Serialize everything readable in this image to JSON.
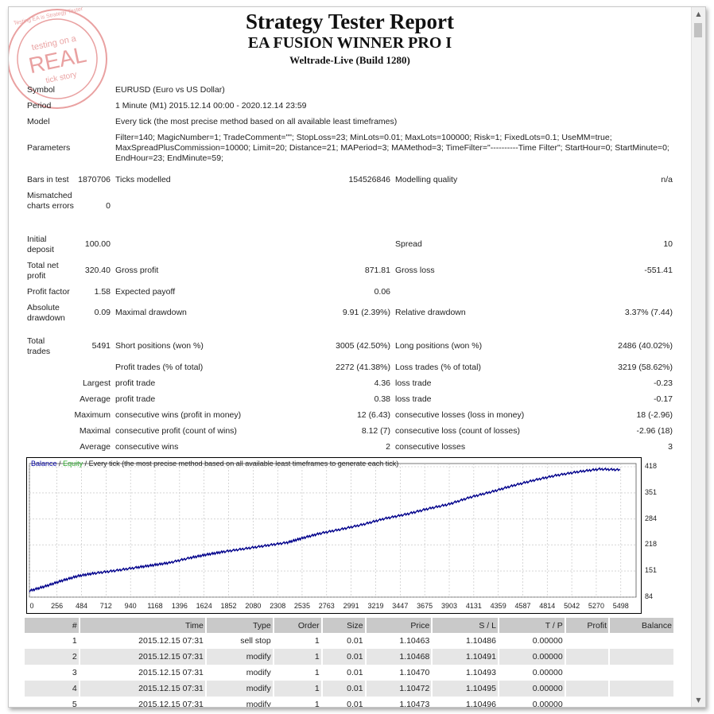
{
  "report": {
    "title": "Strategy Tester Report",
    "ea_name": "EA FUSION WINNER PRO I",
    "server": "Weltrade-Live (Build 1280)"
  },
  "stamp": {
    "text_top": "testing on a",
    "text_main": "REAL",
    "text_bottom": "tick story",
    "ring_text": "Testing EA is Strategy Tester"
  },
  "info": {
    "symbol_label": "Symbol",
    "symbol_value": "EURUSD (Euro vs US Dollar)",
    "period_label": "Period",
    "period_value": "1 Minute (M1) 2015.12.14 00:00 - 2020.12.14 23:59",
    "model_label": "Model",
    "model_value": "Every tick (the most precise method based on all available least timeframes)",
    "parameters_label": "Parameters",
    "parameters_value": "Filter=140; MagicNumber=1; TradeComment=\"\"; StopLoss=23; MinLots=0.01; MaxLots=100000; Risk=1; FixedLots=0.1; UseMM=true; MaxSpreadPlusCommission=10000; Limit=20; Distance=21; MAPeriod=3; MAMethod=3; TimeFilter=\"----------Time Filter\"; StartHour=0; StartMinute=0; EndHour=23; EndMinute=59;"
  },
  "stats": {
    "bars_label": "Bars in test",
    "bars_value": "1870706",
    "ticks_label": "Ticks modelled",
    "ticks_value": "154526846",
    "quality_label": "Modelling quality",
    "quality_value": "n/a",
    "mismatch_label": "Mismatched charts errors",
    "mismatch_value": "0",
    "deposit_label": "Initial deposit",
    "deposit_value": "100.00",
    "spread_label": "Spread",
    "spread_value": "10",
    "netprofit_label": "Total net profit",
    "netprofit_value": "320.40",
    "grossprofit_label": "Gross profit",
    "grossprofit_value": "871.81",
    "grossloss_label": "Gross loss",
    "grossloss_value": "-551.41",
    "pf_label": "Profit factor",
    "pf_value": "1.58",
    "payoff_label": "Expected payoff",
    "payoff_value": "0.06",
    "absdd_label": "Absolute drawdown",
    "absdd_value": "0.09",
    "maxdd_label": "Maximal drawdown",
    "maxdd_value": "9.91 (2.39%)",
    "reldd_label": "Relative drawdown",
    "reldd_value": "3.37% (7.44)",
    "trades_label": "Total trades",
    "trades_value": "5491",
    "short_label": "Short positions (won %)",
    "short_value": "3005 (42.50%)",
    "long_label": "Long positions (won %)",
    "long_value": "2486 (40.02%)",
    "profittrades_label": "Profit trades (% of total)",
    "profittrades_value": "2272 (41.38%)",
    "losstrades_label": "Loss trades (% of total)",
    "losstrades_value": "3219 (58.62%)",
    "largest_label": "Largest",
    "largest_profit_label": "profit trade",
    "largest_profit_value": "4.36",
    "largest_loss_label": "loss trade",
    "largest_loss_value": "-0.23",
    "average_label": "Average",
    "average_profit_label": "profit trade",
    "average_profit_value": "0.38",
    "average_loss_label": "loss trade",
    "average_loss_value": "-0.17",
    "maximum_label": "Maximum",
    "max_wins_label": "consecutive wins (profit in money)",
    "max_wins_value": "12 (6.43)",
    "max_losses_label": "consecutive losses (loss in money)",
    "max_losses_value": "18 (-2.96)",
    "maximal_label": "Maximal",
    "maximal_profit_label": "consecutive profit (count of wins)",
    "maximal_profit_value": "8.12 (7)",
    "maximal_loss_label": "consecutive loss (count of losses)",
    "maximal_loss_value": "-2.96 (18)",
    "average2_label": "Average",
    "avg_wins_label": "consecutive wins",
    "avg_wins_value": "2",
    "avg_losses_label": "consecutive losses",
    "avg_losses_value": "3"
  },
  "chart_data": {
    "type": "line",
    "legend_balance": "Balance",
    "legend_sep": "/",
    "legend_equity": "Equity",
    "title": "/ Every tick (the most precise method based on all available least timeframes to generate each tick)",
    "x_ticks": [
      "0",
      "256",
      "484",
      "712",
      "940",
      "1168",
      "1396",
      "1624",
      "1852",
      "2080",
      "2308",
      "2535",
      "2763",
      "2991",
      "3219",
      "3447",
      "3675",
      "3903",
      "4131",
      "4359",
      "4587",
      "4814",
      "5042",
      "5270",
      "5498"
    ],
    "y_ticks": [
      "418",
      "351",
      "284",
      "218",
      "151",
      "84"
    ],
    "xlim": [
      0,
      5640
    ],
    "ylim": [
      84,
      418
    ],
    "grid": true,
    "series": [
      {
        "name": "Balance",
        "color": "#00008b",
        "x": [
          0,
          150,
          300,
          450,
          600,
          800,
          1000,
          1150,
          1300,
          1500,
          1650,
          1800,
          2000,
          2200,
          2400,
          2535,
          2700,
          2900,
          3100,
          3300,
          3500,
          3700,
          3900,
          4100,
          4300,
          4500,
          4700,
          4900,
          5100,
          5300,
          5491
        ],
        "y": [
          100,
          112,
          126,
          138,
          145,
          152,
          160,
          166,
          172,
          185,
          193,
          200,
          208,
          216,
          224,
          235,
          247,
          258,
          270,
          285,
          296,
          310,
          322,
          340,
          354,
          370,
          384,
          396,
          405,
          412,
          410
        ]
      }
    ]
  },
  "orders": {
    "headers": [
      "#",
      "Time",
      "Type",
      "Order",
      "Size",
      "Price",
      "S / L",
      "T / P",
      "Profit",
      "Balance"
    ],
    "rows": [
      [
        "1",
        "2015.12.15 07:31",
        "sell stop",
        "1",
        "0.01",
        "1.10463",
        "1.10486",
        "0.00000",
        "",
        ""
      ],
      [
        "2",
        "2015.12.15 07:31",
        "modify",
        "1",
        "0.01",
        "1.10468",
        "1.10491",
        "0.00000",
        "",
        ""
      ],
      [
        "3",
        "2015.12.15 07:31",
        "modify",
        "1",
        "0.01",
        "1.10470",
        "1.10493",
        "0.00000",
        "",
        ""
      ],
      [
        "4",
        "2015.12.15 07:31",
        "modify",
        "1",
        "0.01",
        "1.10472",
        "1.10495",
        "0.00000",
        "",
        ""
      ],
      [
        "5",
        "2015.12.15 07:31",
        "modify",
        "1",
        "0.01",
        "1.10473",
        "1.10496",
        "0.00000",
        "",
        ""
      ]
    ]
  }
}
